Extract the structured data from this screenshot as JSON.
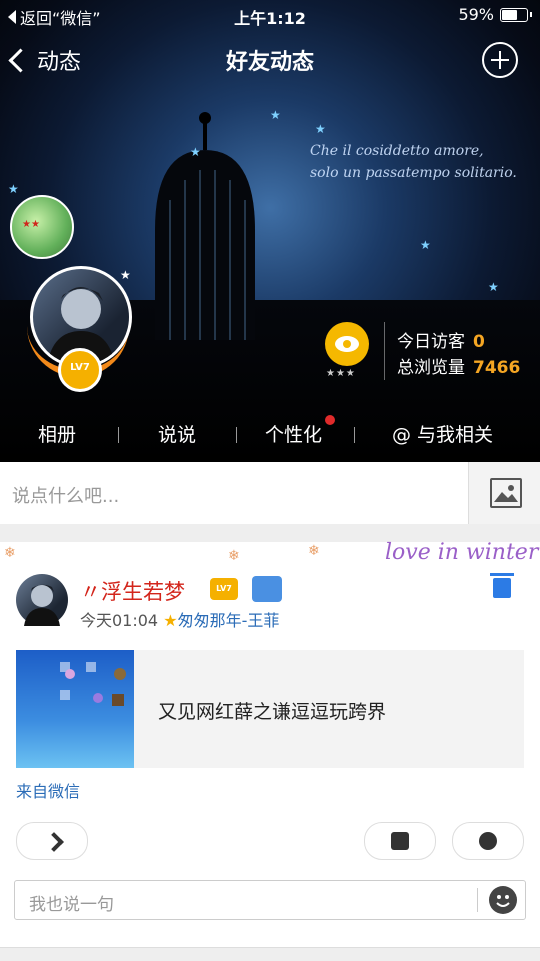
{
  "status_bar": {
    "back_label": "返回“微信”",
    "time": "上午1:12",
    "battery": "59%"
  },
  "nav": {
    "back_label": "动态",
    "title": "好友动态"
  },
  "banner": {
    "quote_line1": "Che il cosiddetto amore,",
    "quote_line2": "solo un passatempo solitario."
  },
  "profile": {
    "level": "LV7",
    "visitors_label": "今日访客",
    "visitors_value": "0",
    "views_label": "总浏览量",
    "views_value": "7466"
  },
  "tabs": [
    "相册",
    "说说",
    "个性化",
    "@ 与我相关"
  ],
  "compose": {
    "placeholder": "说点什么吧..."
  },
  "post": {
    "decoration": "love in winter",
    "author": "〃浮生若梦",
    "author_level": "LV7",
    "time": "今天01:04",
    "song": "匆匆那年-王菲",
    "link_title": "又见网红薛之谦逗逗玩跨界",
    "source": "来自微信",
    "reply_placeholder": "我也说一句"
  },
  "colors": {
    "accent_orange": "#f5a623",
    "link_blue": "#2b6cb7",
    "name_red": "#d3251b"
  }
}
